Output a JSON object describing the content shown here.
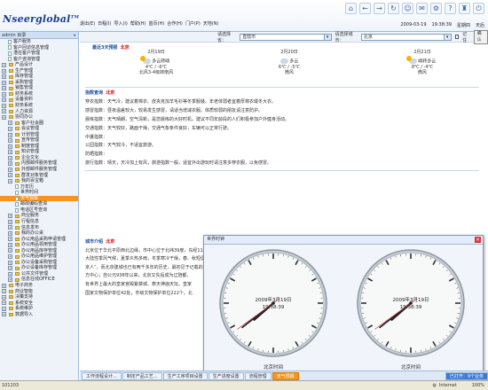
{
  "logo": "Nseerglobal",
  "logo_tm": "TM",
  "top_menu": [
    "退出(E)",
    "日程(I)",
    "导入(I)",
    "帮助(H)",
    "首页(H)",
    "合作(H)",
    "门户(P)",
    "天地(N)"
  ],
  "header_icons": [
    "home-icon",
    "back-icon",
    "forward-icon",
    "refresh-icon",
    "user-icon",
    "mail-icon",
    "gear-icon",
    "help-icon",
    "lock-icon",
    "exit-icon"
  ],
  "header_info": {
    "date": "2009-03-19",
    "time": "19:38:39",
    "weekday": "星期四",
    "misc": "天后"
  },
  "side": {
    "top_label": "admin 目录",
    "items": [
      {
        "t": "客户服务",
        "l": 1,
        "k": "dc"
      },
      {
        "t": "客户回访信息管理",
        "l": 1,
        "k": "dc"
      },
      {
        "t": "潜在客户管理",
        "l": 1,
        "k": "dc"
      },
      {
        "t": "客户咨询管理",
        "l": 1,
        "k": "dc"
      },
      {
        "t": "产品设计",
        "l": 0,
        "k": "bx"
      },
      {
        "t": "生产管理",
        "l": 0,
        "k": "bx"
      },
      {
        "t": "库存管理",
        "l": 0,
        "k": "bx"
      },
      {
        "t": "采购管理",
        "l": 0,
        "k": "bx"
      },
      {
        "t": "销售管理",
        "l": 0,
        "k": "bx"
      },
      {
        "t": "财务系统",
        "l": 0,
        "k": "bx"
      },
      {
        "t": "设备资料",
        "l": 0,
        "k": "bx"
      },
      {
        "t": "财务系统",
        "l": 0,
        "k": "bx"
      },
      {
        "t": "人力资源",
        "l": 0,
        "k": "bx"
      },
      {
        "t": "协同办公",
        "l": 0,
        "k": "bx"
      },
      {
        "t": "客户社会圈",
        "l": 1,
        "k": "bx"
      },
      {
        "t": "会议管理",
        "l": 1,
        "k": "bx"
      },
      {
        "t": "计划管理",
        "l": 1,
        "k": "bx"
      },
      {
        "t": "宣传管理",
        "l": 1,
        "k": "bx"
      },
      {
        "t": "制度管理",
        "l": 1,
        "k": "bx"
      },
      {
        "t": "知识管理",
        "l": 1,
        "k": "bx"
      },
      {
        "t": "企业文化",
        "l": 1,
        "k": "bx"
      },
      {
        "t": "内部邮件服务管理",
        "l": 1,
        "k": "bx"
      },
      {
        "t": "外部邮件服务管理",
        "l": 1,
        "k": "bx"
      },
      {
        "t": "群发对象管理",
        "l": 1,
        "k": "bx"
      },
      {
        "t": "我的百宝箱",
        "l": 1,
        "k": "bx"
      },
      {
        "t": "万年历",
        "l": 2,
        "k": "dc"
      },
      {
        "t": "世界时间",
        "l": 2,
        "k": "dc"
      },
      {
        "t": "天气预报",
        "l": 2,
        "k": "dc",
        "sel": true
      },
      {
        "t": "邮政编码查询",
        "l": 2,
        "k": "dc"
      },
      {
        "t": "电话区号查询",
        "l": 2,
        "k": "dc"
      },
      {
        "t": "商业服务",
        "l": 1,
        "k": "bx"
      },
      {
        "t": "行程信息",
        "l": 1,
        "k": "bx"
      },
      {
        "t": "信息发布",
        "l": 1,
        "k": "bx"
      },
      {
        "t": "我的办公桌",
        "l": 1,
        "k": "bx"
      },
      {
        "t": "办公用品采购申请管理",
        "l": 1,
        "k": "bx"
      },
      {
        "t": "办公用品领用管理",
        "l": 1,
        "k": "bx"
      },
      {
        "t": "办公用品库存管理",
        "l": 1,
        "k": "bx"
      },
      {
        "t": "办公用品维护管理",
        "l": 1,
        "k": "bx"
      },
      {
        "t": "办公设备采购管理",
        "l": 1,
        "k": "bx"
      },
      {
        "t": "办公设备库存管理",
        "l": 1,
        "k": "bx"
      },
      {
        "t": "公共文件管理",
        "l": 1,
        "k": "bx"
      },
      {
        "t": "信息在线OFFICE",
        "l": 1,
        "k": "bx"
      },
      {
        "t": "电子商务",
        "l": 0,
        "k": "bx"
      },
      {
        "t": "商业智能",
        "l": 0,
        "k": "bx"
      },
      {
        "t": "决策支持",
        "l": 0,
        "k": "bx"
      },
      {
        "t": "系统安全",
        "l": 0,
        "k": "bx"
      },
      {
        "t": "系统维护",
        "l": 0,
        "k": "bx"
      },
      {
        "t": "数据导入",
        "l": 0,
        "k": "bx"
      }
    ]
  },
  "selector": {
    "province_label": "请选择省：",
    "province": "直辖市",
    "city_label": "请选择城市：",
    "city": "北京",
    "check_label": "记住",
    "button": "确认"
  },
  "forecast": {
    "title": "最近3天预报",
    "city": "北京",
    "days": [
      {
        "date": "2月19日",
        "weather": "多云转晴",
        "temp": "4℃ / -6℃",
        "wind": "北风3-4级转南风"
      },
      {
        "date": "2月20日",
        "weather": "多云",
        "temp": "6℃ / -5℃",
        "wind": "微风"
      },
      {
        "date": "2月21日",
        "weather": "晴转多云",
        "temp": "8℃ / -4℃",
        "wind": "微风"
      }
    ]
  },
  "life": {
    "title": "指数查询",
    "city": "北京",
    "lines": [
      "穿衣指数：天气冷，建议着棉衣、皮夹克加羊毛衫等冬季服装。年老体弱者宜着厚棉衣或冬大衣。",
      "感冒指数：昼夜温差较大，较易发生感冒，请适当增减衣服。体质较弱的朋友请注意防护。",
      "晨练指数：天气晴朗，空气清新，是您晨练的大好时机，建议不同年龄段的人们积极参加户外健身活动。",
      "交通指数：天气较好，路面干燥，交通气象条件良好，车辆可以正常行驶。",
      "中暑指数：",
      "公园指数：天气较冷，不适宜旅游。",
      "防晒指数：",
      "旅行指数：晴天，天冷加上有风，旅游指数一般，适宜外出游玩时请注意多穿衣服，以免感冒。"
    ]
  },
  "city_intro": {
    "title": "城市介绍",
    "city": "北京",
    "lines": [
      "北京位于华北平原西北边缘，市中心位于北纬39度，东经116度，四周被河北省围着，东南和天津市相接。全市面积一万六千多平方公里，辖16区2县，人口1000余万，北京为暖温带半湿润",
      "大陆性季风气候，夏季炎热多雨，冬季寒冷干燥，春、秋短促，年平均气温10-12摄氏度。北京是世界历史文化名城和古都之一。早在七十万年前，北京周口店地区就出现了原始人群部落“北",
      "京人”。而北京建城也已有两千多年的历史，最初见于记载的名字为“蓟”。公元前1045年北京成为蓟、燕等诸侯国的都城；公元前221年秦始皇统一中国以来，北京一直是中国北方重镇和地",
      "方中心；自公元938年以来，北京又先后成为辽陪都、",
      "有世界上最大的皇家宫殿紫禁城、祭天神庙天坛、皇家",
      "国家文物保护单位42处，市级文物保护单位222个。北"
    ]
  },
  "popup": {
    "title": "世界时钟",
    "clocks": [
      {
        "name": "北京时间",
        "date": "2009年3月19日",
        "time": "19:38:39",
        "hour": 19,
        "minute": 38,
        "second": 39
      },
      {
        "name": "北京时间",
        "date": "2009年3月19日",
        "time": "19:38:39",
        "hour": 19,
        "minute": 38,
        "second": 39
      }
    ]
  },
  "tabs": [
    {
      "t": "工作流程设计..."
    },
    {
      "t": "制定产品工艺..."
    },
    {
      "t": "生产工序项目设置"
    },
    {
      "t": "生产进度设置"
    },
    {
      "t": "流程管理"
    },
    {
      "t": "天气预报",
      "act": true
    },
    {
      "t": "已打开：9个业务",
      "blue": true
    }
  ],
  "status": {
    "left": "101103",
    "right_zone": "Internet",
    "zoom": "100%"
  }
}
